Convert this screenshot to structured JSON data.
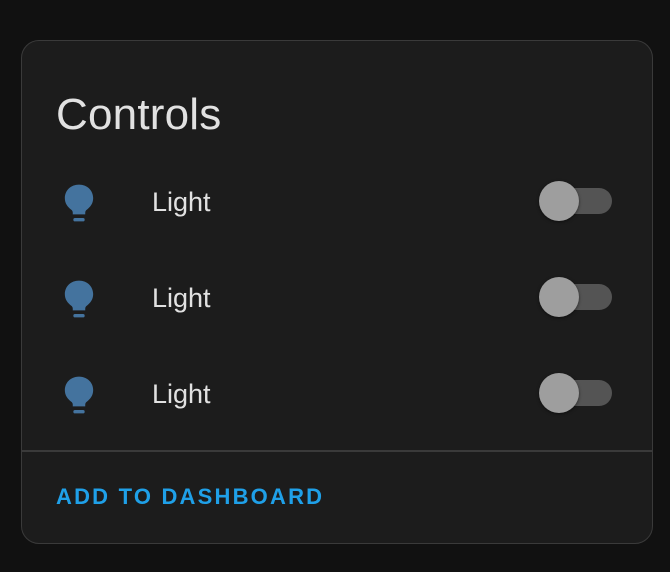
{
  "card": {
    "title": "Controls",
    "entities": [
      {
        "name": "Light",
        "icon": "lightbulb-icon",
        "state": "off"
      },
      {
        "name": "Light",
        "icon": "lightbulb-icon",
        "state": "off"
      },
      {
        "name": "Light",
        "icon": "lightbulb-icon",
        "state": "off"
      }
    ],
    "action_label": "ADD TO DASHBOARD"
  },
  "colors": {
    "page_background": "#111111",
    "card_background": "#1c1c1c",
    "icon_color": "#44739e",
    "text_color": "#e1e1e1",
    "accent": "#1fa0e8",
    "toggle_thumb_off": "#9e9e9e",
    "toggle_track_off": "#545454"
  }
}
